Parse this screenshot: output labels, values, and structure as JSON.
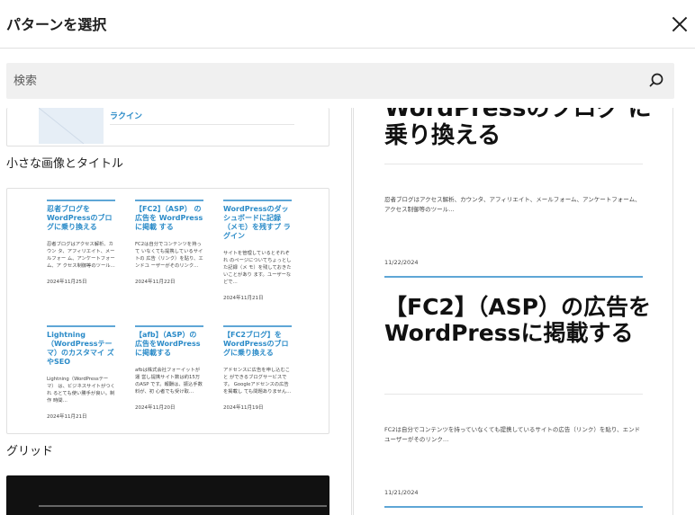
{
  "modal": {
    "title": "パターンを選択",
    "close_label": "閉じる"
  },
  "search": {
    "placeholder": "検索"
  },
  "patterns": [
    {
      "label": "小さな画像とタイトル",
      "thumb_link_text": "ラクイン"
    },
    {
      "label": "グリッド",
      "items": [
        {
          "title": "忍者ブログを WordPressのブロ グに乗り換える",
          "excerpt": "忍者ブログはアクセス解析、カウン タ、アフィリエイト、メールフォー ム、アンケートフォーム、ア クセス制御等のツール…",
          "date": "2024年11月25日"
        },
        {
          "title": "【FC2】（ASP） の広告を WordPressに掲載 する",
          "excerpt": "FC2は自分でコンテンツを持って いなくても提携しているサイトの 広告（リンク）を貼り、エンドユ ーザーがそのリンク…",
          "date": "2024年11月22日"
        },
        {
          "title": "WordPressのダッ シュボードに記録 （メモ）を残すプ ラグイン",
          "excerpt": "サイトを管理しているとそれぞれ のページについてちょっとした記録（メ モ）を残しておきたいことがあり ます。ユーザーなどで…",
          "date": "2024年11月21日"
        },
        {
          "title": "Lightning （WordPressテー マ）のカスタマイ ズやSEO",
          "excerpt": "Lightning（WordPressテーマ） は、ビジネスサイトがつくれ るとても使い勝手が良い。制作 時間…",
          "date": "2024年11月21日"
        },
        {
          "title": "【afb】（ASP）の 広告をWordPress に掲載する",
          "excerpt": "afbは株式会社フォーイットが運 営し提携サイト数は約15万のASP です。報酬は、振込手数料が、初 心者でも受け取…",
          "date": "2024年11月20日"
        },
        {
          "title": "【FC2ブログ】を WordPressのブロ グに乗り換える",
          "excerpt": "アドセンスに広告を申し込むこと ができるブログサービスです。 Googleアドセンスの広告を掲載し ても問題ありません…",
          "date": "2024年11月19日"
        }
      ]
    },
    {
      "label": ""
    }
  ],
  "preview": {
    "clipped_title": "WordPressのブログ に乗り換える",
    "posts": [
      {
        "excerpt": "忍者ブログはアクセス解析、カウンタ、アフィリエイト、メールフォーム、アンケートフォーム、アクセス制御等のツール…",
        "date": "11/22/2024"
      },
      {
        "title": "【FC2】（ASP）の広告をWordPressに掲載する",
        "excerpt": "FC2は自分でコンテンツを持っていなくても提携しているサイトの広告（リンク）を貼り、エンドユーザーがそのリンク…",
        "date": "11/21/2024"
      }
    ]
  }
}
